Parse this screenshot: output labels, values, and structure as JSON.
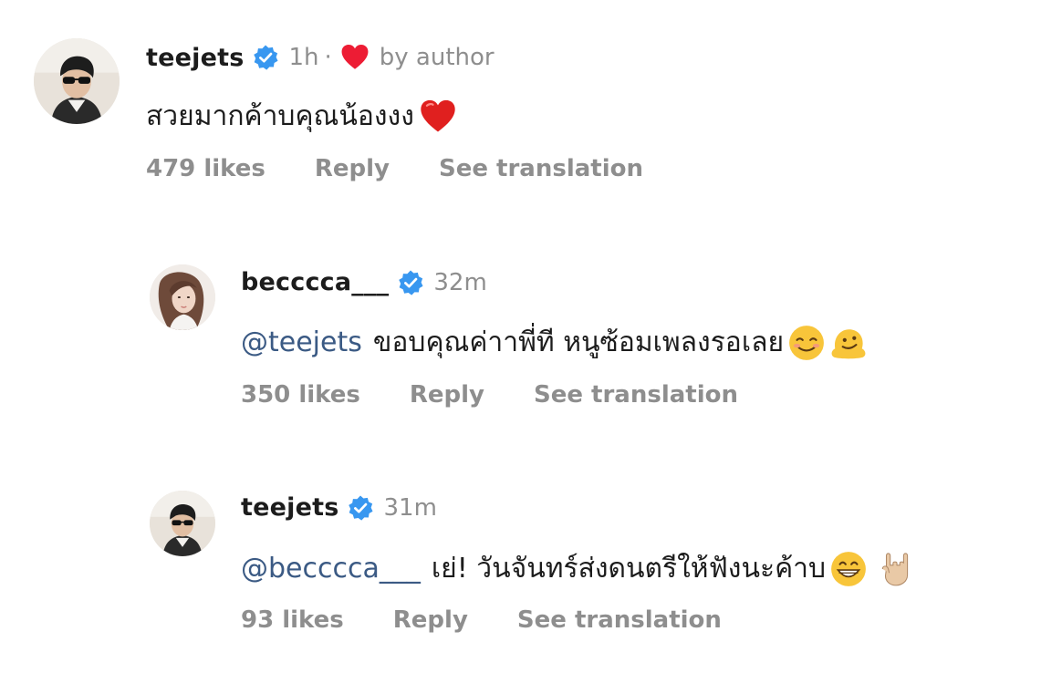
{
  "comments": [
    {
      "username": "teejets",
      "time": "1h",
      "separator": "·",
      "by_author": "by author",
      "mention": "",
      "text": "สวยมากค้าบคุณน้องงง",
      "emojis": [
        "red-heart-emoji"
      ],
      "likes": "479 likes",
      "reply": "Reply",
      "see_translation": "See translation"
    },
    {
      "username": "becccca___",
      "time": "32m",
      "mention": "@teejets",
      "text": "ขอบคุณค่าาพี่ที หนูซ้อมเพลงรอเลย",
      "emojis": [
        "smiling-face-emoji",
        "melting-face-emoji"
      ],
      "likes": "350 likes",
      "reply": "Reply",
      "see_translation": "See translation"
    },
    {
      "username": "teejets",
      "time": "31m",
      "mention": "@becccca___",
      "text": "เย่! วันจันทร์ส่งดนตรีให้ฟังนะค้าบ",
      "emojis": [
        "grinning-face-emoji",
        "sign-of-horns-emoji"
      ],
      "likes": "93 likes",
      "reply": "Reply",
      "see_translation": "See translation"
    }
  ],
  "colors": {
    "verified": "#3897f0",
    "mention": "#3b5a84",
    "meta": "#8e8e8e",
    "heart": "#ed4956"
  }
}
